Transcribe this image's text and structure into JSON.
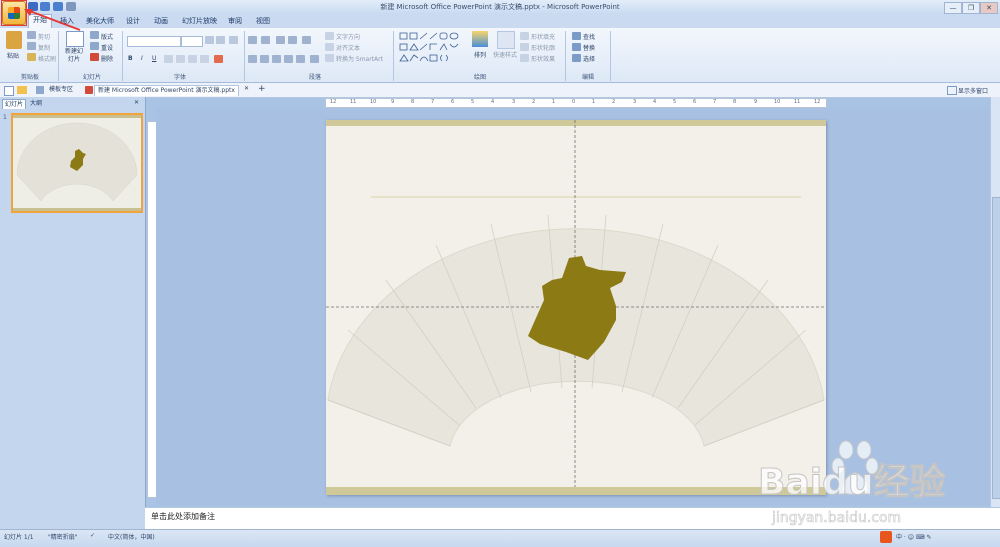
{
  "window": {
    "title": "新建 Microsoft Office PowerPoint 演示文稿.pptx - Microsoft PowerPoint",
    "controls": [
      "—",
      "❐",
      "✕"
    ]
  },
  "tabs": [
    "开始",
    "插入",
    "美化大师",
    "设计",
    "动画",
    "幻灯片放映",
    "审阅",
    "视图"
  ],
  "ribbon": {
    "clipboard": {
      "label": "剪贴板",
      "paste": "粘贴",
      "cut": "剪切",
      "copy": "复制",
      "format_painter": "格式刷"
    },
    "slides": {
      "label": "幻灯片",
      "new_slide": "新建幻灯片",
      "layout": "版式",
      "reset": "重设",
      "delete": "删除"
    },
    "font": {
      "label": "字体",
      "font_name": "",
      "font_size": ""
    },
    "paragraph": {
      "label": "段落",
      "text_direction": "文字方向",
      "align_text": "对齐文本",
      "smartart": "转换为 SmartArt"
    },
    "drawing": {
      "label": "绘图",
      "arrange": "排列",
      "quick_styles": "快速样式",
      "shape_fill": "形状填充",
      "shape_outline": "形状轮廓",
      "shape_effects": "形状效果"
    },
    "editing": {
      "label": "编辑",
      "find": "查找",
      "replace": "替换",
      "select": "选择"
    }
  },
  "doc_tabs": {
    "home": "模板专区",
    "document": "新建 Microsoft Office PowerPoint 演示文稿.pptx",
    "add": "+",
    "multi_window": "显示多窗口"
  },
  "left_panel": {
    "tab_slides": "幻灯片",
    "tab_outline": "大纲",
    "slide_number": "1"
  },
  "ruler": {
    "h_labels": [
      "12",
      "11",
      "10",
      "9",
      "8",
      "7",
      "6",
      "5",
      "4",
      "3",
      "2",
      "1",
      "0",
      "1",
      "2",
      "3",
      "4",
      "5",
      "6",
      "7",
      "8",
      "9",
      "10",
      "11",
      "12"
    ]
  },
  "notes": {
    "placeholder": "单击此处添加备注"
  },
  "status": {
    "slide_info": "幻灯片 1/1",
    "theme": "\"精密折扇\"",
    "language": "中文(简体，中国)"
  },
  "watermark": {
    "brand": "Baidu经验",
    "url": "jingyan.baidu.com"
  },
  "colors": {
    "accent_orange": "#f3a33c",
    "shape_olive": "#8c7a14",
    "ribbon_blue": "#c9daf1",
    "annotation_red": "#e53935"
  }
}
